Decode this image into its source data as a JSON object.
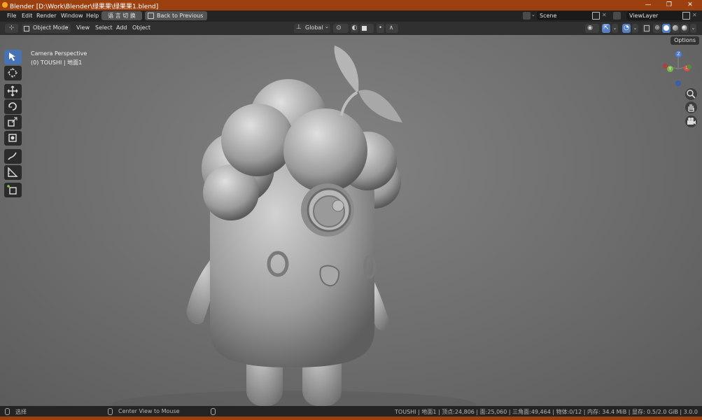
{
  "window": {
    "title": "Blender [D:\\Work\\Blender\\绿果果\\绿果果1.blend]",
    "minimize": "—",
    "maximize": "❐",
    "close": "✕"
  },
  "menu": {
    "file": "File",
    "edit": "Edit",
    "render": "Render",
    "window": "Window",
    "help": "Help",
    "language_toggle": "语 言 切 换",
    "back_to_previous": "Back to Previous"
  },
  "scene": {
    "name": "Scene",
    "view_layer": "ViewLayer"
  },
  "header": {
    "mode": "Object Mode",
    "view": "View",
    "select": "Select",
    "add": "Add",
    "object": "Object",
    "orientation": "Global"
  },
  "viewport": {
    "overlay_line1": "Camera Perspective",
    "overlay_line2": "(0) TOUSHI | 地面1",
    "options": "Options",
    "axis_x": "X",
    "axis_y": "Y",
    "axis_z": "Z"
  },
  "status": {
    "left_action": "选择",
    "middle_action": "Center View to Mouse",
    "right_info": "TOUSHI | 地面1 | 顶点:24,806 | 面:25,060 | 三角面:49,464 | 物体:0/12 | 内存: 34.4 MiB | 显存: 0.5/2.0 GiB | 3.0.0"
  },
  "colors": {
    "titlebar": "#9c4010",
    "active_tool": "#4772b3",
    "axis_x": "#e04a4a",
    "axis_y": "#7ab84a",
    "axis_z": "#4a7ee0"
  }
}
